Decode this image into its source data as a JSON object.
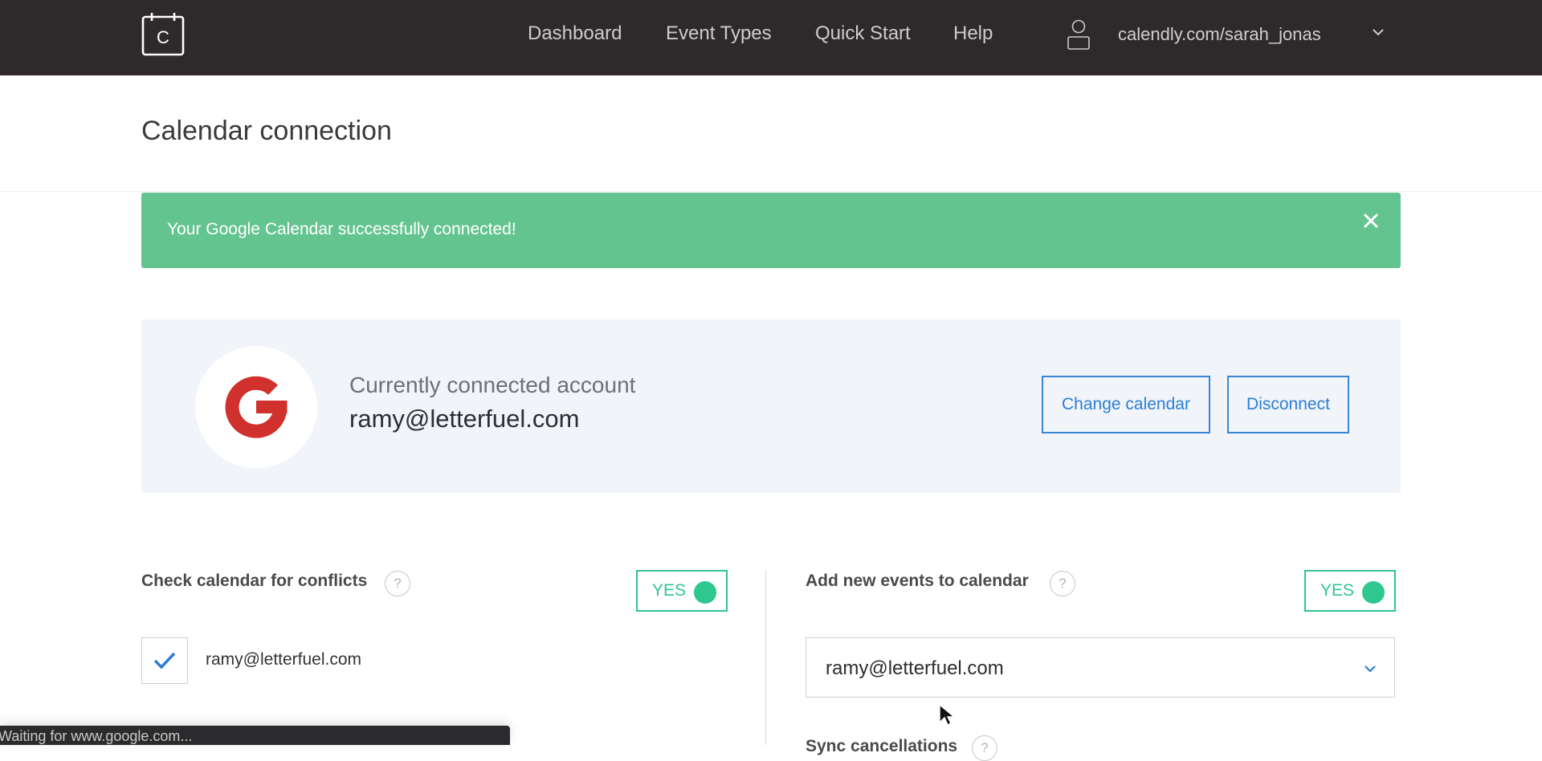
{
  "topbar": {
    "logo_letter": "C",
    "nav": [
      {
        "label": "Dashboard"
      },
      {
        "label": "Event Types"
      },
      {
        "label": "Quick Start"
      },
      {
        "label": "Help"
      }
    ],
    "user_url": "calendly.com/sarah_jonas",
    "icons": {
      "logo": "calendly-logo-icon",
      "user": "user-icon",
      "caret": "chevron-down-icon"
    }
  },
  "page": {
    "title": "Calendar connection"
  },
  "alert": {
    "message": "Your Google Calendar successfully connected!",
    "close_icon": "close-icon",
    "color": "#64c490"
  },
  "account": {
    "provider_icon": "google-g-icon",
    "label": "Currently connected account",
    "email": "ramy@letterfuel.com",
    "change_button": "Change calendar",
    "disconnect_button": "Disconnect"
  },
  "conflicts": {
    "title": "Check calendar for conflicts",
    "help": "?",
    "toggle_label": "YES",
    "toggle_on": true,
    "calendars": [
      {
        "label": "ramy@letterfuel.com",
        "checked": true
      }
    ]
  },
  "add_events": {
    "title": "Add new events to calendar",
    "help": "?",
    "toggle_label": "YES",
    "toggle_on": true,
    "selected_calendar": "ramy@letterfuel.com"
  },
  "sync": {
    "title": "Sync cancellations",
    "help": "?"
  },
  "browser_status": {
    "text": "Waiting for www.google.com..."
  },
  "colors": {
    "topbar": "#2e2a2b",
    "accent_blue": "#2d7ed4",
    "toggle_green": "#2ec78f",
    "card_bg": "#f1f4f9",
    "google_red": "#d0312d"
  }
}
